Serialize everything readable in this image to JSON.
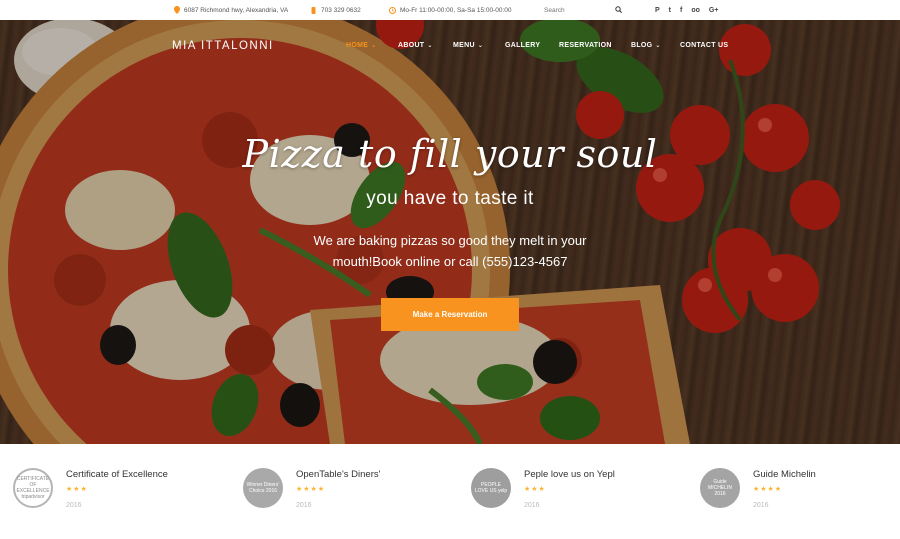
{
  "topbar": {
    "address": "6087 Richmond hwy, Alexandria, VA",
    "phone": "703 329 0632",
    "hours": "Mo-Fr 11:00-00:00, Sa-Sa 15:00-00:00",
    "search_placeholder": "Search",
    "social": [
      "P",
      "t",
      "f",
      "oo",
      "G+"
    ],
    "accent": "#f7931e"
  },
  "header": {
    "brand": "MIA ITTALONNI",
    "nav": [
      {
        "label": "HOME",
        "dropdown": true,
        "active": true
      },
      {
        "label": "ABOUT",
        "dropdown": true,
        "active": false
      },
      {
        "label": "MENU",
        "dropdown": true,
        "active": false
      },
      {
        "label": "GALLERY",
        "dropdown": false,
        "active": false
      },
      {
        "label": "RESERVATION",
        "dropdown": false,
        "active": false
      },
      {
        "label": "BLOG",
        "dropdown": true,
        "active": false
      },
      {
        "label": "CONTACT US",
        "dropdown": false,
        "active": false
      }
    ]
  },
  "hero": {
    "headline": "Pizza to fill your soul",
    "subline": "you have to taste it",
    "description": "We are baking pizzas so good they melt in your mouth!Book online or call (555)123-4567",
    "cta": "Make a Reservation"
  },
  "awards": [
    {
      "badge": "CERTIFICATE OF EXCELLENCE tripadvisor",
      "title": "Certificate of Excellence",
      "stars": "★★★",
      "year": "2016"
    },
    {
      "badge": "Winner Diners' Choice 2016",
      "title": "OpenTable's Diners'",
      "stars": "★★★★",
      "year": "2016"
    },
    {
      "badge": "PEOPLE LOVE US yelp",
      "title": "Peple love us on Yepl",
      "stars": "★★★",
      "year": "2016"
    },
    {
      "badge": "Guide MICHELIN 2016",
      "title": "Guide Michelin",
      "stars": "★★★★",
      "year": "2016"
    }
  ]
}
